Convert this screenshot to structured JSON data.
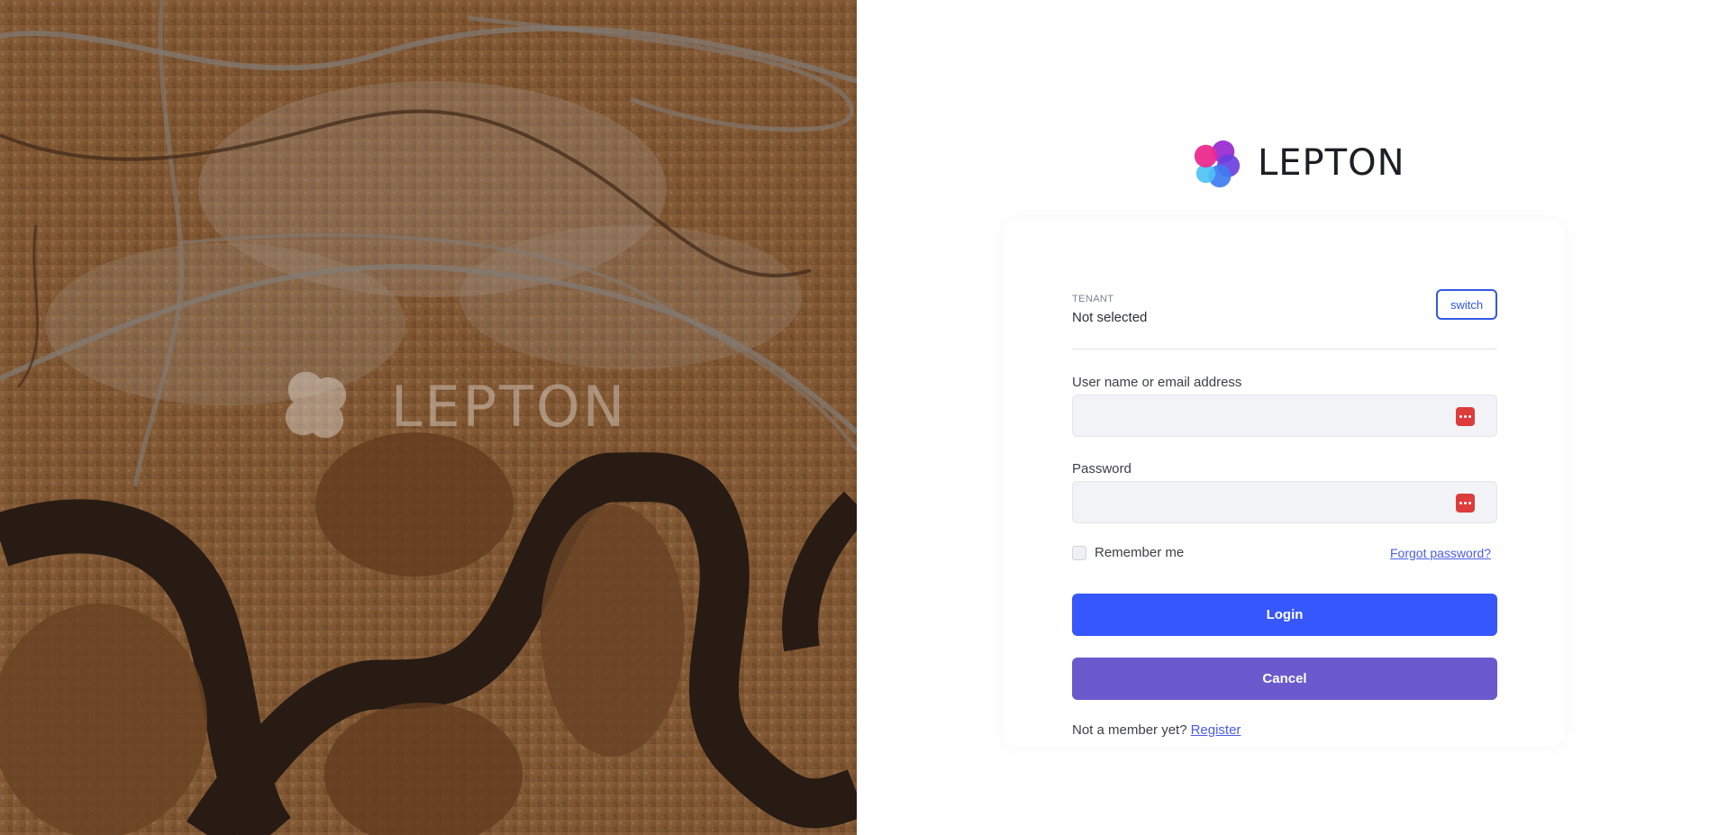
{
  "brand": {
    "name": "LEPTON"
  },
  "hero": {
    "watermark_text": "LEPTON"
  },
  "tenant": {
    "caption": "TENANT",
    "value": "Not selected",
    "switch_label": "switch"
  },
  "username": {
    "label": "User name or email address",
    "value": ""
  },
  "password": {
    "label": "Password",
    "value": ""
  },
  "remember": {
    "label": "Remember me",
    "checked": false
  },
  "forgot_password": "Forgot password?",
  "login_label": "Login",
  "cancel_label": "Cancel",
  "register": {
    "prompt": "Not a member yet?",
    "link": "Register"
  },
  "colors": {
    "primary": "#3557fb",
    "secondary": "#6a5acd",
    "link": "#4b5ce6",
    "password_icon": "#dc3c3c"
  },
  "icons": [
    "lepton-logo-icon",
    "password-manager-icon"
  ]
}
